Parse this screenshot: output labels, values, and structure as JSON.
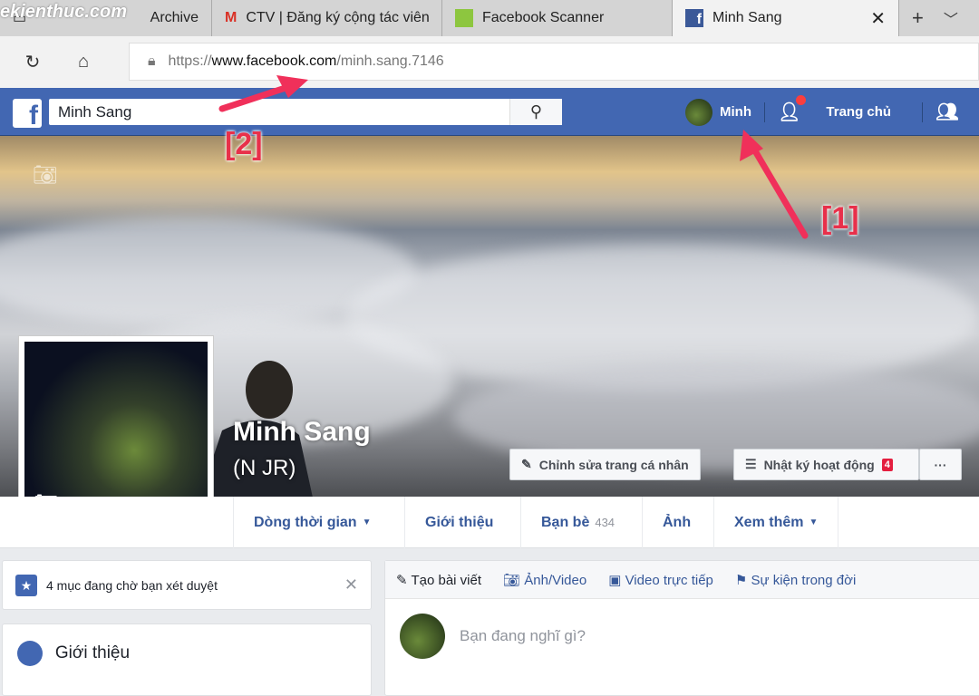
{
  "browser": {
    "tabs": [
      {
        "title": "Archive",
        "icon": "page-icon"
      },
      {
        "title": "CTV | Đăng ký cộng tác viên",
        "icon": "gmail-icon"
      },
      {
        "title": "Facebook Scanner",
        "icon": "app-icon"
      },
      {
        "title": "Minh Sang",
        "icon": "facebook-icon",
        "active": true
      }
    ],
    "url_scheme": "https://",
    "url_domain": "www.facebook.com",
    "url_path": "/minh.sang.7146"
  },
  "fb": {
    "search_value": "Minh Sang",
    "user": "Minh",
    "home": "Trang chủ",
    "brand_color": "#4267b2"
  },
  "profile": {
    "name": "Minh Sang",
    "alt_name": "(N JR)",
    "edit_profile": "Chỉnh sửa trang cá nhân",
    "activity_log": "Nhật ký hoạt động",
    "activity_count": "4",
    "more": "···",
    "nav": [
      {
        "label": "Dòng thời gian",
        "dropdown": true
      },
      {
        "label": "Giới thiệu"
      },
      {
        "label": "Bạn bè",
        "count": "434"
      },
      {
        "label": "Ảnh"
      },
      {
        "label": "Xem thêm",
        "dropdown": true
      }
    ]
  },
  "left": {
    "pending": "4 mục đang chờ bạn xét duyệt",
    "intro": "Giới thiệu"
  },
  "composer": {
    "tabs": [
      "Tạo bài viết",
      "Ảnh/Video",
      "Video trực tiếp",
      "Sự kiện trong đời"
    ],
    "placeholder": "Bạn đang nghĩ gì?"
  },
  "annotations": {
    "a1": "[1]",
    "a2": "[2]",
    "color": "#e8304a"
  },
  "watermark": "chiasekienthuc — CHIA SẺ KIẾN THỨC"
}
